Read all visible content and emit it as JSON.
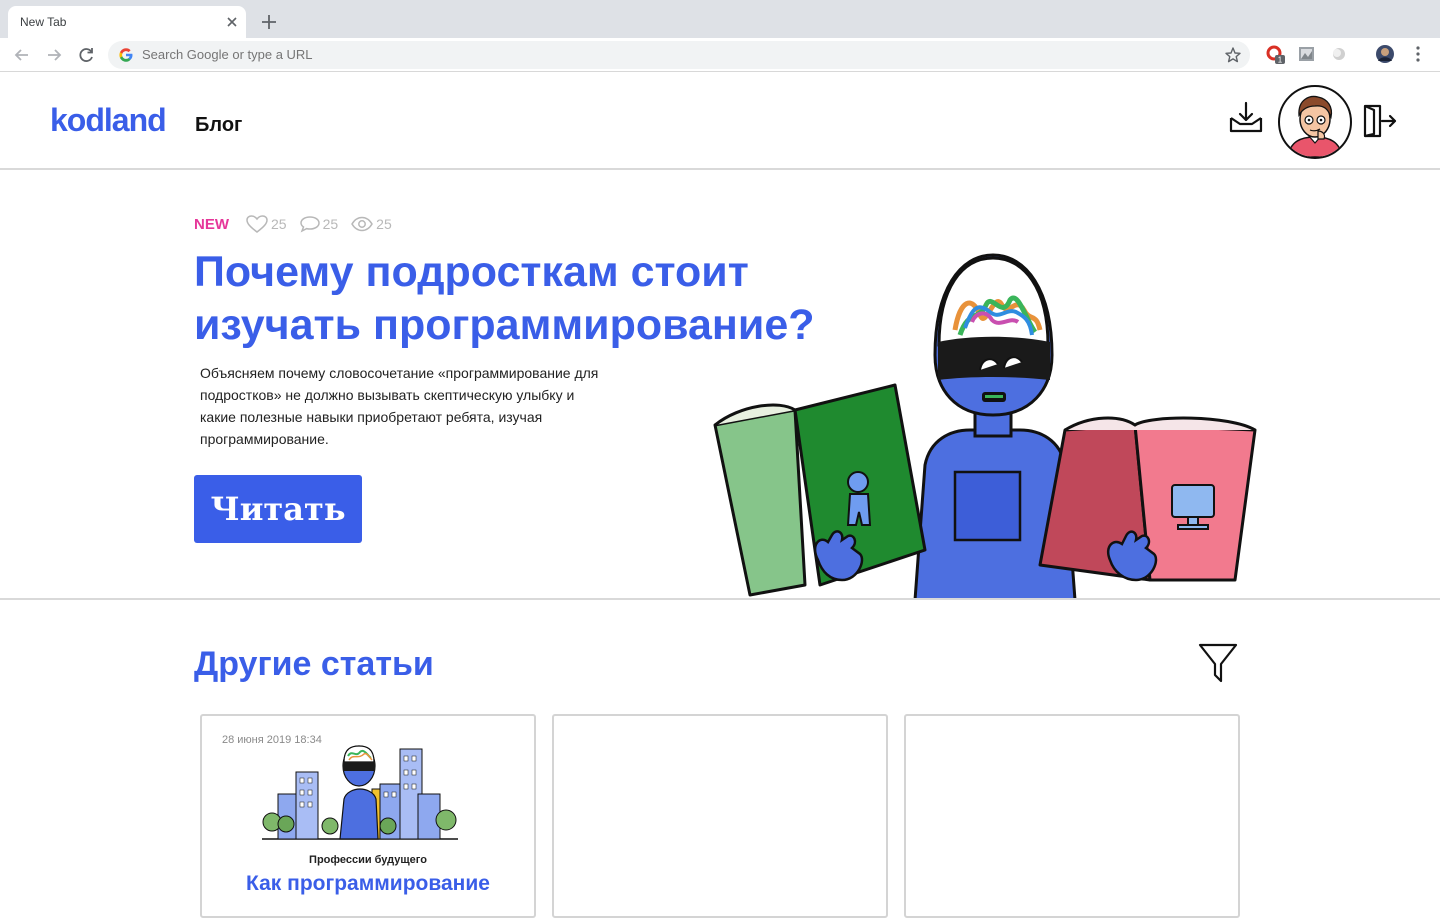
{
  "browser": {
    "tab_title": "New Tab",
    "omnibox_placeholder": "Search Google or type a URL",
    "extension_badge": "1"
  },
  "header": {
    "logo": "kodland",
    "section": "Блог"
  },
  "hero": {
    "badge": "NEW",
    "likes": "25",
    "comments": "25",
    "views": "25",
    "title": "Почему подросткам стоит изучать программирование?",
    "description": "Объясняем почему словосочетание «программирование для подростков» не должно вызывать скептическую улыбку и какие полезные навыки приобретают ребята, изучая программирование.",
    "button_label": "Читать"
  },
  "articles": {
    "title": "Другие статьи",
    "cards": [
      {
        "date": "28 июня 2019 18:34",
        "category": "Профессии будущего",
        "title": "Как программирование"
      },
      {},
      {}
    ]
  },
  "colors": {
    "brand": "#3a5ee8",
    "badge_new": "#e6379a",
    "muted": "#b8b8b8"
  }
}
